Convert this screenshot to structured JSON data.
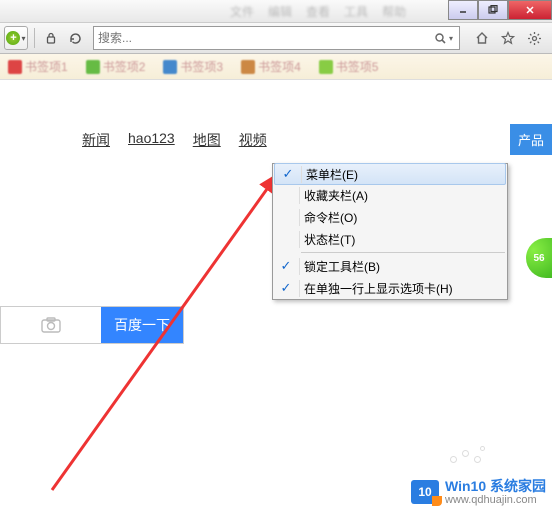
{
  "window": {
    "min": "–",
    "max": "❐",
    "close": "✕"
  },
  "menubar_blur": [
    "文件",
    "编辑",
    "查看",
    "工具",
    "帮助"
  ],
  "toolbar": {
    "search_placeholder": "搜索...",
    "plus": "+",
    "dropdown": "▾"
  },
  "bookmarks": [
    {
      "color": "#d44",
      "label": "书签项1"
    },
    {
      "color": "#6b4",
      "label": "书签项2"
    },
    {
      "color": "#48c",
      "label": "书签项3"
    },
    {
      "color": "#c84",
      "label": "书签项4"
    },
    {
      "color": "#8c4",
      "label": "书签项5"
    }
  ],
  "nav": {
    "items": [
      "新闻",
      "hao123",
      "地图",
      "视频"
    ]
  },
  "product_btn": "产品",
  "green_ball": "56",
  "baidu": {
    "button": "百度一下"
  },
  "context_menu": {
    "items": [
      {
        "checked": true,
        "label": "菜单栏(E)",
        "highlight": true
      },
      {
        "checked": false,
        "label": "收藏夹栏(A)"
      },
      {
        "checked": false,
        "label": "命令栏(O)"
      },
      {
        "checked": false,
        "label": "状态栏(T)"
      }
    ],
    "items2": [
      {
        "checked": true,
        "label": "锁定工具栏(B)"
      },
      {
        "checked": true,
        "label": "在单独一行上显示选项卡(H)"
      }
    ]
  },
  "watermark": {
    "logo": "10",
    "line1": "Win10 系统家园",
    "line2": "www.qdhuajin.com"
  }
}
